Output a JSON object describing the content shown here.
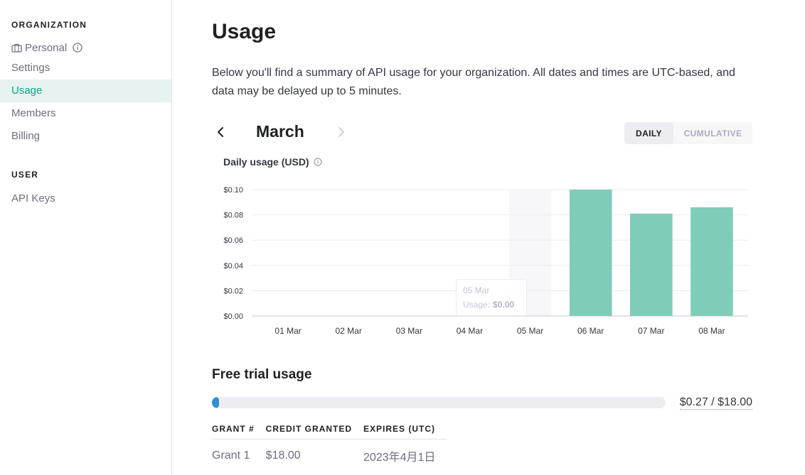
{
  "sidebar": {
    "org_heading": "ORGANIZATION",
    "org_name": "Personal",
    "items": [
      {
        "label": "Settings",
        "active": false
      },
      {
        "label": "Usage",
        "active": true
      },
      {
        "label": "Members",
        "active": false
      },
      {
        "label": "Billing",
        "active": false
      }
    ],
    "user_heading": "USER",
    "user_items": [
      {
        "label": "API Keys"
      }
    ]
  },
  "main": {
    "title": "Usage",
    "description": "Below you'll find a summary of API usage for your organization. All dates and times are UTC-based, and data may be delayed up to 5 minutes.",
    "month": "March",
    "toggle": {
      "daily": "DAILY",
      "cumulative": "CUMULATIVE",
      "selected": "DAILY"
    },
    "chart_title": "Daily usage (USD)"
  },
  "chart_data": {
    "type": "bar",
    "title": "Daily usage (USD)",
    "categories": [
      "01 Mar",
      "02 Mar",
      "03 Mar",
      "04 Mar",
      "05 Mar",
      "06 Mar",
      "07 Mar",
      "08 Mar"
    ],
    "values": [
      0,
      0,
      0,
      0,
      0,
      0.1,
      0.081,
      0.086
    ],
    "y_ticks": [
      "$0.00",
      "$0.02",
      "$0.04",
      "$0.06",
      "$0.08",
      "$0.10"
    ],
    "ylim": [
      0,
      0.1
    ],
    "grid": true,
    "bar_color": "#7fcdb8",
    "hover_category_index": 4
  },
  "tooltip": {
    "date": "05 Mar",
    "label": "Usage:",
    "value": "$0.00"
  },
  "free_trial": {
    "title": "Free trial usage",
    "used": 0.27,
    "total": 18.0,
    "label": "$0.27 / $18.00",
    "bar_color": "#2f8fd8"
  },
  "grants": {
    "headers": [
      "GRANT #",
      "CREDIT GRANTED",
      "EXPIRES (UTC)"
    ],
    "rows": [
      [
        "Grant 1",
        "$18.00",
        "2023年4月1日"
      ]
    ]
  },
  "colors": {
    "accent": "#10a37f",
    "active_bg": "#e6f3f1"
  }
}
